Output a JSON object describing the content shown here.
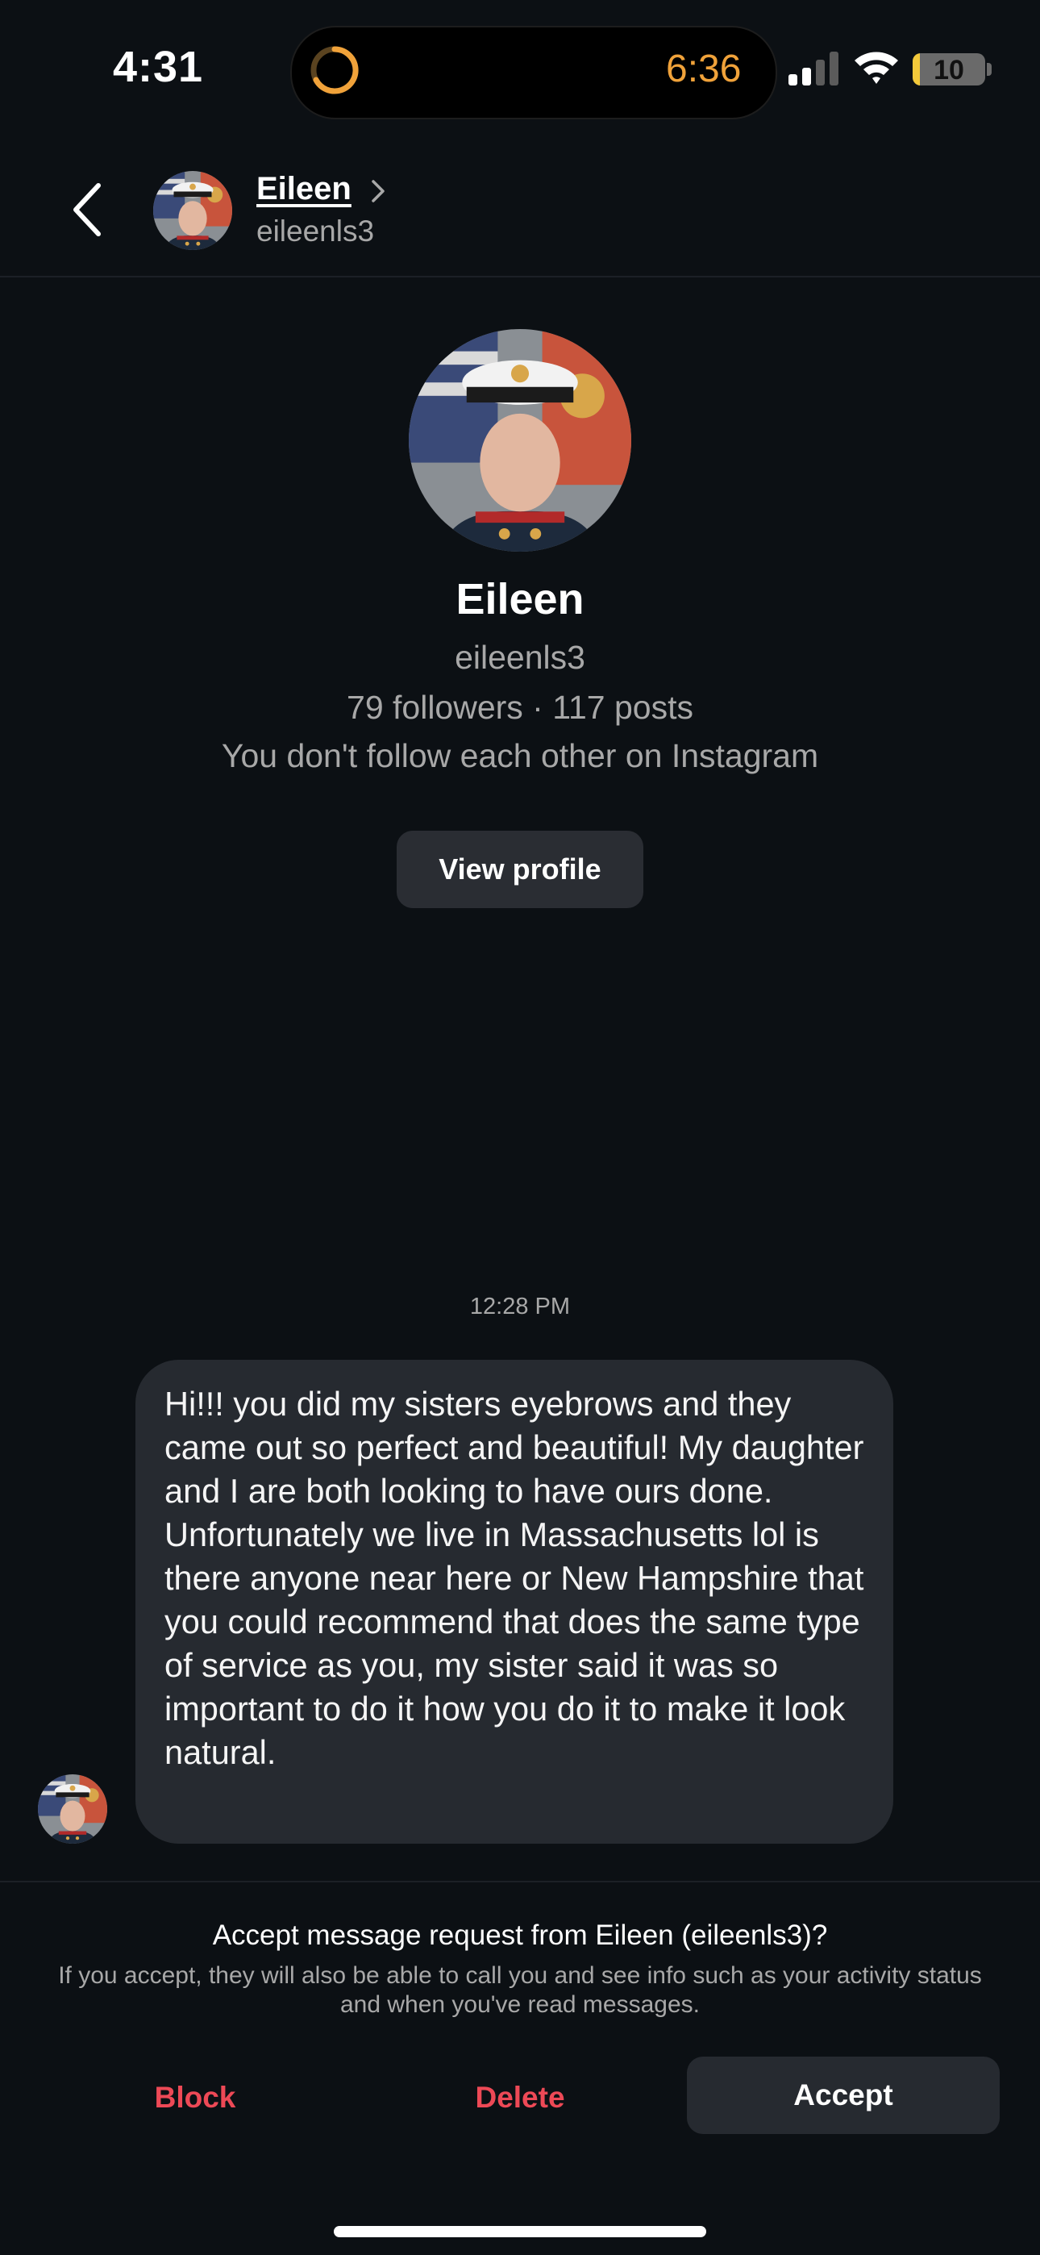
{
  "status_bar": {
    "time": "4:31",
    "timer": "6:36",
    "battery": "10",
    "battery_level": 0.1
  },
  "header": {
    "name": "Eileen",
    "username": "eileenls3"
  },
  "profile": {
    "name": "Eileen",
    "username": "eileenls3",
    "stats": "79 followers · 117 posts",
    "follow_status": "You don't follow each other on Instagram",
    "view_profile_label": "View profile"
  },
  "message": {
    "timestamp": "12:28 PM",
    "text": "Hi!!! you did my sisters eyebrows and they came out so perfect and beautiful! My daughter and I are both looking to have ours done. Unfortunately we live in Massachusetts lol is there anyone near here or New Hampshire that you could recommend that does the same type of service as you, my sister said it was so important to do it how you do it to make it look natural."
  },
  "request": {
    "title": "Accept message request from Eileen (eileenls3)?",
    "subtitle": "If you accept, they will also be able to call you and see info such as your activity status and when you've read messages.",
    "block_label": "Block",
    "delete_label": "Delete",
    "accept_label": "Accept"
  },
  "colors": {
    "background": "#0c1014",
    "danger": "#ed4956",
    "bubble": "#262a30",
    "timer": "#f0a23a"
  },
  "icons": [
    "timer-icon",
    "signal-icon",
    "wifi-icon",
    "battery-icon",
    "back-arrow-icon",
    "chevron-right-icon",
    "avatar-image"
  ]
}
